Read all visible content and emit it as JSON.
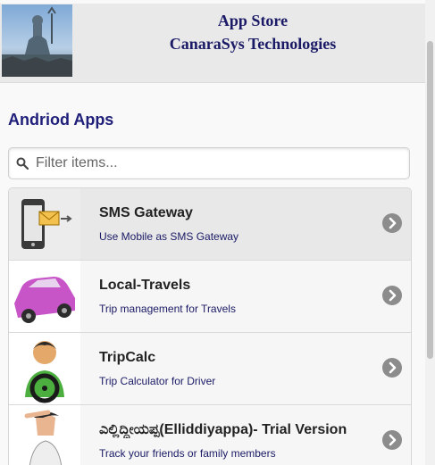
{
  "header": {
    "title_line1": "App Store",
    "title_line2": "CanaraSys Technologies",
    "logo_icon": "shiva-statue-logo"
  },
  "section": {
    "title": "Andriod Apps"
  },
  "search": {
    "placeholder": "Filter items...",
    "value": "",
    "icon": "search-icon"
  },
  "apps": [
    {
      "name": "SMS Gateway",
      "description": "Use Mobile as SMS Gateway",
      "icon": "phone-sms-icon"
    },
    {
      "name": "Local-Travels",
      "description": "Trip management for Travels",
      "icon": "car-icon"
    },
    {
      "name": "TripCalc",
      "description": "Trip Calculator for Driver",
      "icon": "driver-icon"
    },
    {
      "name": "ಎಲ್ಲಿದ್ದೀಯಪ್ಪ(Elliddiyappa)- Trial Version",
      "description": "Track your friends or family members",
      "icon": "person-searching-icon"
    }
  ],
  "colors": {
    "title": "#1a1a66",
    "link": "#1f1f7a",
    "header_bg": "#e9e9e9",
    "chevron": "#8c8c8c"
  }
}
